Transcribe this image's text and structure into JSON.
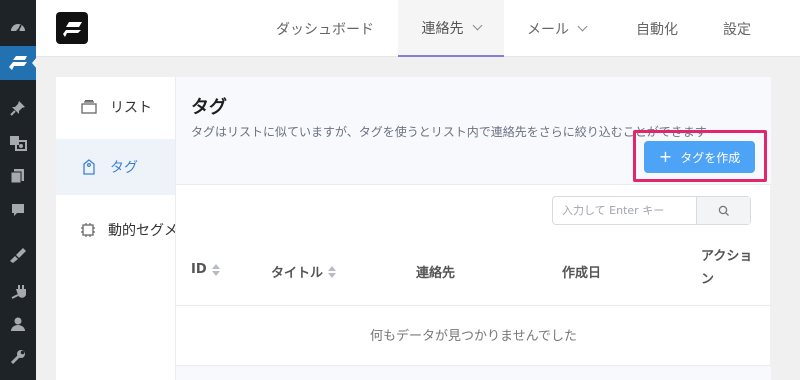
{
  "wp_sidebar": {
    "icons": [
      "dashboard-icon",
      "fluentcrm-icon",
      "pin-icon",
      "media-icon",
      "pages-icon",
      "comments-icon",
      "appearance-icon",
      "plugins-icon",
      "users-icon",
      "tools-icon"
    ]
  },
  "header": {
    "nav": [
      {
        "label": "ダッシュボード"
      },
      {
        "label": "連絡先"
      },
      {
        "label": "メール"
      },
      {
        "label": "自動化"
      },
      {
        "label": "設定"
      }
    ]
  },
  "sidebar": {
    "items": [
      {
        "label": "リスト",
        "icon": "list-icon"
      },
      {
        "label": "タグ",
        "icon": "tag-icon"
      },
      {
        "label": "動的セグメント",
        "icon": "chip-icon"
      }
    ]
  },
  "main": {
    "title": "タグ",
    "description": "タグはリストに似ていますが、タグを使うとリスト内で連絡先をさらに絞り込むことができます",
    "create_button": "タグを作成",
    "search": {
      "placeholder": "入力して Enter キー",
      "value": ""
    },
    "table": {
      "columns": [
        "ID",
        "タイトル",
        "連絡先",
        "作成日",
        "アクション"
      ],
      "empty_text": "何もデータが見つかりませんでした"
    }
  },
  "colors": {
    "accent": "#4da3f5",
    "highlight": "#e3256b",
    "wp_sidebar": "#1d2327",
    "wp_active": "#2271b1"
  }
}
